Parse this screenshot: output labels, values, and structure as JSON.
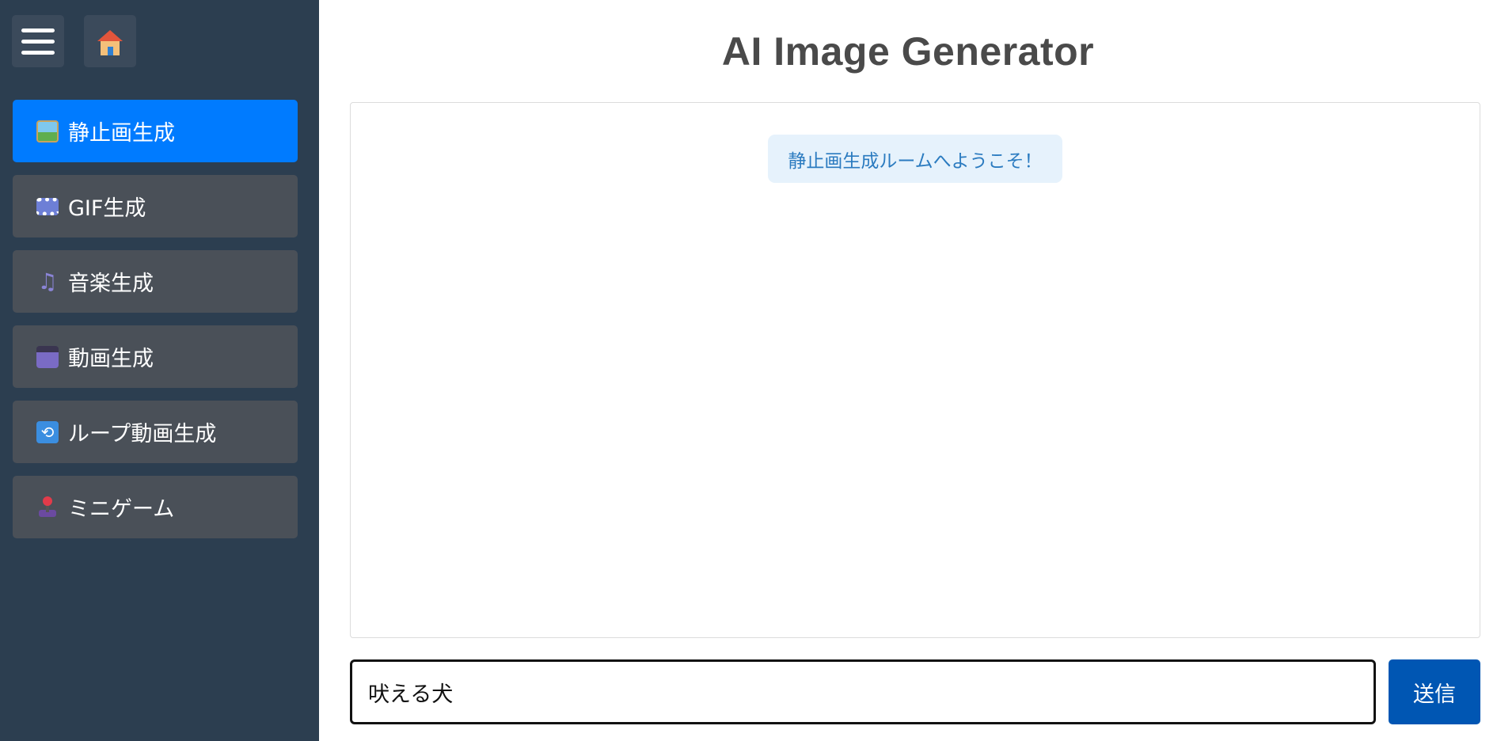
{
  "sidebar": {
    "menu_icon": "hamburger-menu-icon",
    "home_icon": "house-icon",
    "items": [
      {
        "icon": "framed-picture-icon",
        "label": "静止画生成",
        "active": true
      },
      {
        "icon": "film-frames-icon",
        "label": "GIF生成",
        "active": false
      },
      {
        "icon": "musical-notes-icon",
        "label": "音楽生成",
        "active": false
      },
      {
        "icon": "clapper-board-icon",
        "label": "動画生成",
        "active": false
      },
      {
        "icon": "repeat-icon",
        "label": "ループ動画生成",
        "active": false
      },
      {
        "icon": "joystick-icon",
        "label": "ミニゲーム",
        "active": false
      }
    ]
  },
  "header": {
    "title": "AI Image Generator"
  },
  "chat": {
    "welcome_message": "静止画生成ルームへようこそ！"
  },
  "composer": {
    "input_value": "吠える犬",
    "send_label": "送信"
  },
  "colors": {
    "sidebar_bg": "#2c3e50",
    "nav_item_bg": "#4a5058",
    "nav_active_bg": "#007bff",
    "send_button_bg": "#0056b3",
    "welcome_bg": "#e6f2fc",
    "welcome_text": "#2b7bc0"
  }
}
